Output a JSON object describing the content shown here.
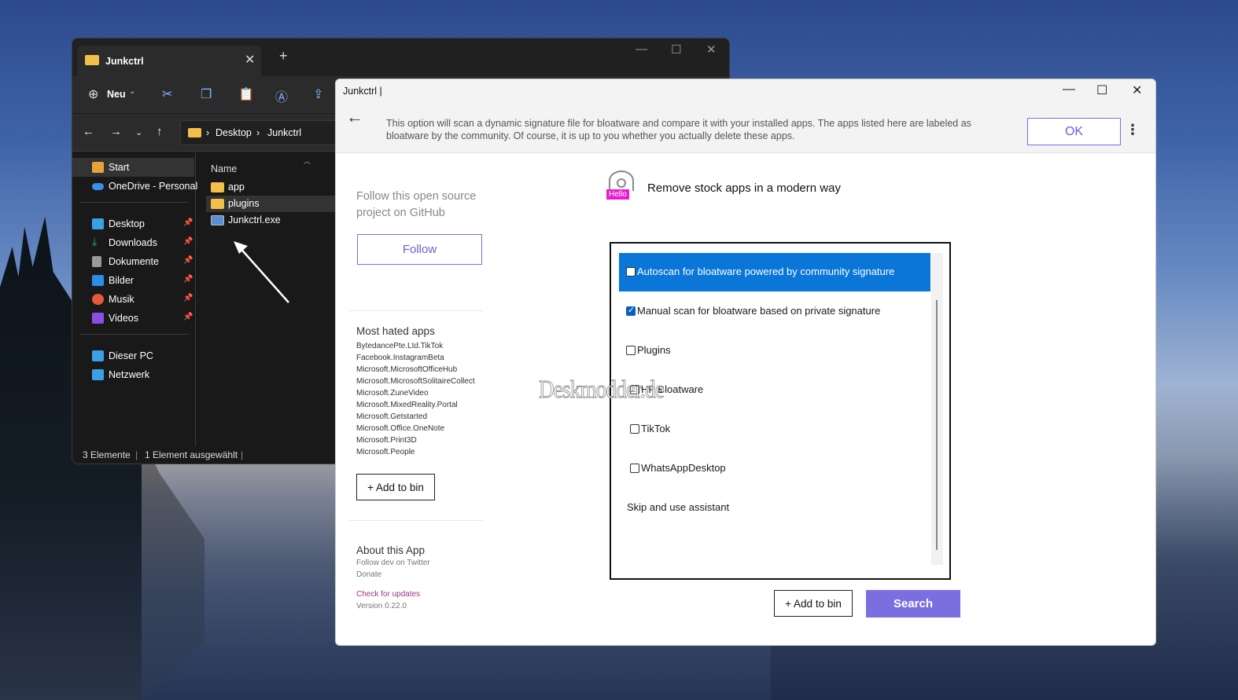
{
  "explorer": {
    "tab_title": "Junkctrl",
    "new_label": "Neu",
    "breadcrumb": [
      "Desktop",
      "Junkctrl"
    ],
    "sidebar": [
      {
        "label": "Start",
        "icon": "home-icon",
        "color": "#e8a23a"
      },
      {
        "label": "OneDrive - Personal",
        "icon": "cloud-icon",
        "color": "#3a8ee6"
      },
      {
        "label": "Desktop",
        "icon": "desktop-icon",
        "color": "#3aa0e6"
      },
      {
        "label": "Downloads",
        "icon": "download-icon",
        "color": "#2fb36b"
      },
      {
        "label": "Dokumente",
        "icon": "document-icon",
        "color": "#9a9a9a"
      },
      {
        "label": "Bilder",
        "icon": "image-icon",
        "color": "#2b8de6"
      },
      {
        "label": "Musik",
        "icon": "music-icon",
        "color": "#e6583a"
      },
      {
        "label": "Videos",
        "icon": "video-icon",
        "color": "#8a4ee6"
      },
      {
        "label": "Dieser PC",
        "icon": "computer-icon",
        "color": "#3aa0e6"
      },
      {
        "label": "Netzwerk",
        "icon": "network-icon",
        "color": "#3aa0e6"
      }
    ],
    "column_header": "Name",
    "files": [
      {
        "label": "app",
        "icon": "folder-icon"
      },
      {
        "label": "plugins",
        "icon": "folder-icon"
      },
      {
        "label": "Junkctrl.exe",
        "icon": "exe-icon"
      }
    ],
    "status_count": "3 Elemente",
    "status_selected": "1 Element ausgewählt"
  },
  "junkctrl": {
    "title": "Junkctrl  |",
    "banner_text": "This option will scan a dynamic signature file for bloatware and compare it with your installed apps. The apps listed here are labeled as bloatware by the community. Of course, it is up to you whether you actually delete these apps.",
    "ok_label": "OK",
    "kebab": "⋮",
    "github_text": "Follow this open source project on GitHub",
    "follow_label": "Follow",
    "most_hated_title": "Most hated apps",
    "most_hated_apps": [
      "BytedancePte.Ltd.TikTok",
      "Facebook.InstagramBeta",
      "Microsoft.MicrosoftOfficeHub",
      "Microsoft.MicrosoftSolitaireCollect",
      "Microsoft.ZuneVideo",
      "Microsoft.MixedReality.Portal",
      "Microsoft.Getstarted",
      "Microsoft.Office.OneNote",
      "Microsoft.Print3D",
      "Microsoft.People"
    ],
    "add_to_bin_label": "+ Add to bin",
    "about_title": "About this App",
    "about_twitter": "Follow dev on Twitter",
    "about_donate": "Donate",
    "about_updates": "Check for updates",
    "about_version": "Version 0.22.0",
    "hello_badge": "Hello",
    "heading": "Remove stock apps in a modern way",
    "options": [
      {
        "label": "Autoscan for bloatware powered by community signature",
        "checked": false
      },
      {
        "label": "Manual scan for bloatware based on private signature",
        "checked": true
      },
      {
        "label": "Plugins",
        "checked": false
      },
      {
        "label": "HP Bloatware",
        "checked": false
      },
      {
        "label": "TikTok",
        "checked": false
      },
      {
        "label": "WhatsAppDesktop",
        "checked": false
      },
      {
        "label": "Skip and use assistant",
        "checked": null
      }
    ],
    "watermark": "Deskmodder.de",
    "search_label": "Search",
    "accent": "#7b6ee0",
    "highlight": "#0a76d8"
  }
}
